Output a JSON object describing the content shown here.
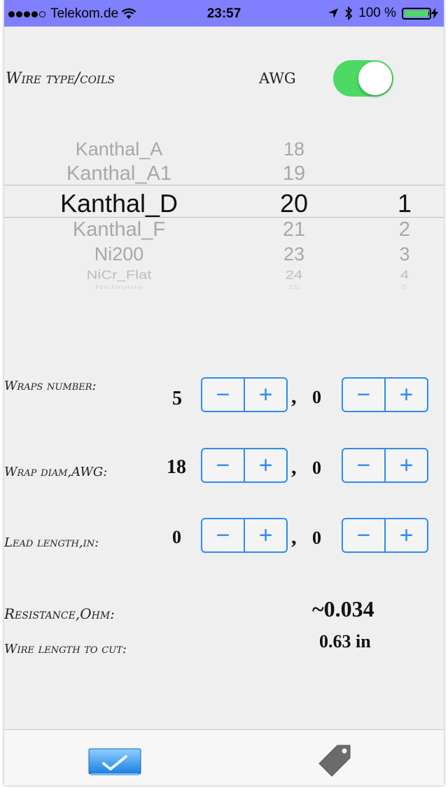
{
  "status_bar": {
    "carrier": "Telekom.de",
    "time": "23:57",
    "battery": "100 %",
    "signal_icon": "signal-dots-icon",
    "wifi_icon": "wifi-icon",
    "location_icon": "location-arrow-icon",
    "bluetooth_icon": "bluetooth-icon",
    "battery_icon": "battery-icon",
    "battery_level": 1.0
  },
  "wire_type": {
    "label": "Wire type/coils",
    "unit": "AWG",
    "toggle_on": true,
    "toggle_color": "#4cd964"
  },
  "picker": {
    "materials": [
      "Kanthal_A",
      "Kanthal_A1",
      "Kanthal_D",
      "Kanthal_F",
      "Ni200",
      "NiCr_Flat",
      "Nichrome"
    ],
    "gauges": [
      "18",
      "19",
      "20",
      "21",
      "23",
      "24",
      "25"
    ],
    "coils": [
      "1",
      "2",
      "3",
      "4",
      "5"
    ],
    "selected_material": "Kanthal_D",
    "selected_gauge": "20",
    "selected_coils": "1"
  },
  "rows": {
    "wraps": {
      "label": "Wraps number:",
      "value_int": "5",
      "value_frac": "0"
    },
    "wrap_diam": {
      "label": "Wrap diam,AWG:",
      "value_int": "18",
      "value_frac": "0"
    },
    "lead_length": {
      "label": "Lead length,in:",
      "value_int": "0",
      "value_frac": "0"
    }
  },
  "stepper": {
    "minus": "−",
    "plus": "+",
    "separator": ","
  },
  "results": {
    "resistance_label": "Resistance,Ohm:",
    "resistance_value": "~0.034",
    "wire_length_label": "Wire length to cut:",
    "wire_length_value": "0.63 in"
  },
  "tabbar": {
    "calculator_icon": "checkmark-card-icon",
    "price_icon": "price-tag-icon"
  },
  "colors": {
    "accent": "#2d8cf0",
    "status_bar": "#8080ff"
  }
}
